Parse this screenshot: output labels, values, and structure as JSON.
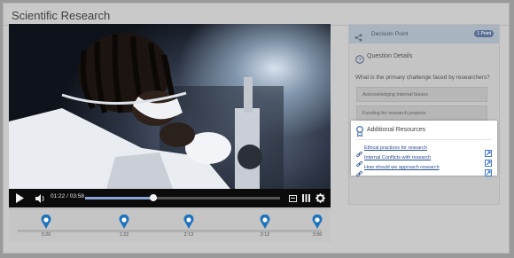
{
  "window": {
    "title": "Scientific Research"
  },
  "video": {
    "current_time": "01:22",
    "duration": "03:58",
    "progress": 0.35
  },
  "timeline": {
    "markers": [
      {
        "label": "0:20"
      },
      {
        "label": "1:22"
      },
      {
        "label": "2:13"
      },
      {
        "label": "3:12"
      },
      {
        "label": "3:56"
      }
    ]
  },
  "panel": {
    "decision_point": {
      "label": "Decision Point",
      "badge": "1 Point"
    },
    "question_details": {
      "label": "Question Details"
    },
    "question": "What is the primary challenge faced by researchers?",
    "options": [
      "Acknowledging internal biases",
      "Funding for research projects"
    ]
  },
  "resources": {
    "title": "Additional Resources",
    "links": [
      "Ethical practices for research",
      "Internal Conflicts with research",
      "How should we approach research"
    ]
  },
  "colors": {
    "accent": "#1e73be",
    "link": "#2b4d8f",
    "header": "#a9b4c1"
  },
  "icons": [
    "play-icon",
    "volume-icon",
    "captions-icon",
    "chapters-icon",
    "settings-icon",
    "map-pin-icon",
    "share-icon",
    "help-circle-icon",
    "ribbon-icon",
    "link-icon",
    "external-link-icon"
  ]
}
